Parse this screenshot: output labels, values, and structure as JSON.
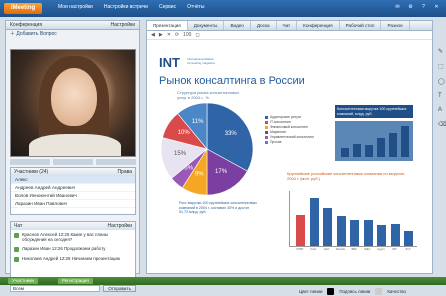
{
  "topbar": {
    "logo": "iMeeting",
    "menu": [
      "Мои настройки",
      "Настройки встречи",
      "Сервис",
      "Отчёты"
    ],
    "right": [
      "✉",
      "⚙",
      "?",
      "✕"
    ]
  },
  "left": {
    "tabs": [
      "Конференция",
      "Настройки"
    ],
    "invite": "Добавить Вопрос",
    "participants": {
      "header": [
        "Участники (24)",
        "Права"
      ],
      "rows": [
        "Алекс",
        "Андреев Андрей Андреевич",
        "Волов Иннокентий Иванович",
        "Ларазин Иван Павлович"
      ]
    },
    "chat": {
      "header": [
        "Чат",
        "Настройки"
      ],
      "messages": [
        "Краснов Алексей 12:25 Какие у вас планы обсуждения на сегодня?",
        "Ларазин Иван 12:26 Продолжаем работу",
        "Николаев Андрей 12:28 Начинаем презентацию"
      ]
    },
    "send": {
      "select": "Всем",
      "button": "Отправить"
    }
  },
  "main": {
    "tabs": [
      "Презентация",
      "Документы",
      "Видео",
      "Доска",
      "Чат",
      "Конференция",
      "Рабочий стол",
      "Разное"
    ],
    "toolbar": [
      "◀",
      "▶",
      "✕",
      "⟳",
      "100",
      "◻"
    ],
    "slide": {
      "brand": "INT",
      "brand_sub": "International Market Consulting magazine",
      "title": "Рынок консалтинга в России",
      "subtitle": "Структура рынка консалтинговых услуг в 2004 г., %",
      "pie": [
        {
          "label": "33%",
          "color": "#2f65a7"
        },
        {
          "label": "17%",
          "color": "#7a3fa0"
        },
        {
          "label": "9%",
          "color": "#f5a623"
        },
        {
          "label": "5%",
          "color": "#9b59b6"
        },
        {
          "label": "15%",
          "color": "#e8e3f1"
        },
        {
          "label": "10%",
          "color": "#d94b4b"
        },
        {
          "label": "11%",
          "color": "#4b86c6"
        }
      ],
      "legend": [
        {
          "label": "Аудиторские услуги",
          "color": "#2f65a7"
        },
        {
          "label": "IT-консалтинг",
          "color": "#d94b4b"
        },
        {
          "label": "Финансовый консалтинг",
          "color": "#f5a623"
        },
        {
          "label": "Маркетинг",
          "color": "#7a3fa0"
        },
        {
          "label": "Управленческий консалтинг",
          "color": "#9b59b6"
        },
        {
          "label": "Прочие",
          "color": "#4b86c6"
        }
      ],
      "note_left": "Рост выручки 100 крупнейших консалтинговых компаний в 2004 г. составил 30% и достиг 51,72 млрд. руб.",
      "box_title": "Консалтинговая выручка 100 крупнейших компаний, млрд. руб.",
      "mini_bars": [
        0.28,
        0.42,
        0.36,
        0.6,
        0.76,
        0.98
      ],
      "chart_title": "Крупнейшие российские консалтинговые компании по выручке, 2004 г. (млн. руб.)",
      "bars": [
        {
          "v": 0.6,
          "color": "#d94b4b",
          "label": "КПМГ"
        },
        {
          "v": 0.92,
          "color": "#2f65a7",
          "label": "PwC"
        },
        {
          "v": 0.74,
          "color": "#2f65a7",
          "label": "E&Y"
        },
        {
          "v": 0.58,
          "color": "#2f65a7",
          "label": "Deloitte"
        },
        {
          "v": 0.5,
          "color": "#2f65a7",
          "label": "ФБК"
        },
        {
          "v": 0.5,
          "color": "#2f65a7",
          "label": "БДО"
        },
        {
          "v": 0.4,
          "color": "#2f65a7",
          "label": "Аудит"
        },
        {
          "v": 0.42,
          "color": "#2f65a7",
          "label": "ЛКГ"
        },
        {
          "v": 0.28,
          "color": "#2f65a7",
          "label": "Ф-Р"
        }
      ]
    },
    "footer": [
      "Цвет линии",
      "Подпись линии",
      "Качество"
    ]
  },
  "bottombar": {
    "b1": "Участники",
    "b2": "Регистрация"
  },
  "righttools": [
    "✎",
    "⬚",
    "◯",
    "T",
    "A",
    "⌫"
  ]
}
